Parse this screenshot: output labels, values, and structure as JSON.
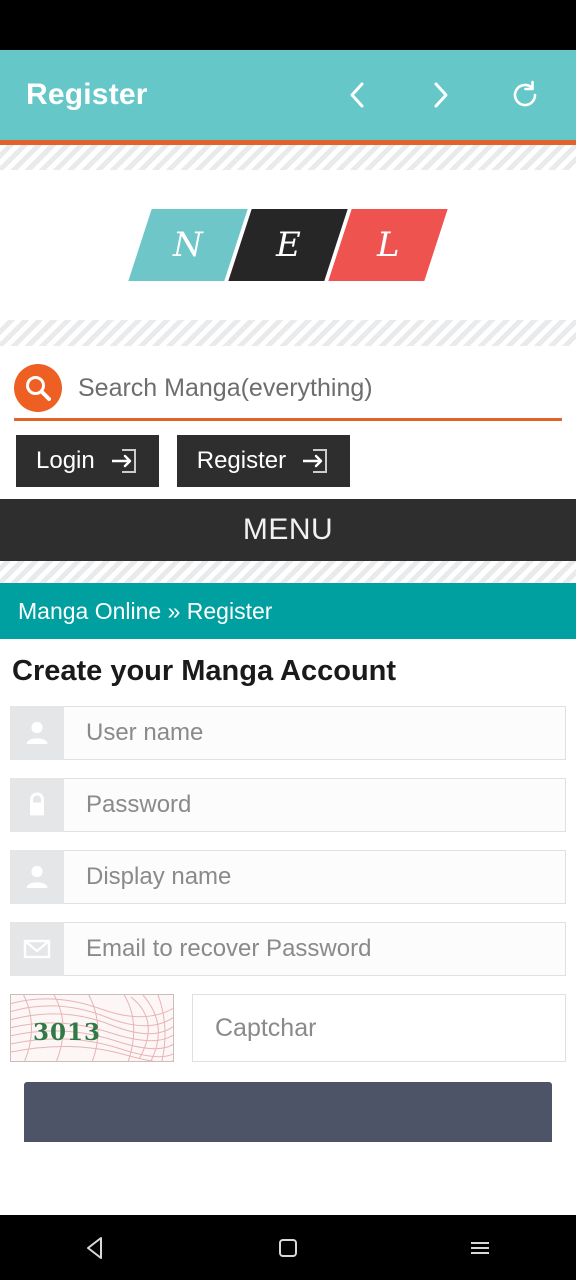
{
  "browser": {
    "title": "Register",
    "icons": {
      "back": "chevron-left-icon",
      "forward": "chevron-right-icon",
      "reload": "refresh-icon"
    }
  },
  "logo": {
    "tiles": [
      {
        "letter": "N",
        "color": "#6ec6c9"
      },
      {
        "letter": "E",
        "color": "#262626"
      },
      {
        "letter": "L",
        "color": "#ef5350"
      }
    ]
  },
  "search": {
    "placeholder": "Search Manga(everything)",
    "value": "",
    "icon": "search-icon",
    "accent_color": "#e2622c"
  },
  "auth": {
    "login_label": "Login",
    "register_label": "Register",
    "icon": "sign-in-icon"
  },
  "menu": {
    "label": "MENU"
  },
  "breadcrumb": {
    "text": "Manga Online » Register",
    "color": "#00a0a0"
  },
  "form": {
    "heading": "Create your Manga Account",
    "fields": [
      {
        "name": "username",
        "placeholder": "User name",
        "value": "",
        "icon": "user-icon",
        "type": "text"
      },
      {
        "name": "password",
        "placeholder": "Password",
        "value": "",
        "icon": "lock-icon",
        "type": "password"
      },
      {
        "name": "displayname",
        "placeholder": "Display name",
        "value": "",
        "icon": "user-icon",
        "type": "text"
      },
      {
        "name": "email",
        "placeholder": "Email to recover Password",
        "value": "",
        "icon": "envelope-icon",
        "type": "text"
      }
    ],
    "captcha": {
      "code": "3013",
      "placeholder": "Captchar",
      "value": ""
    },
    "submit_label": ""
  },
  "android_nav": {
    "back": "back-triangle-icon",
    "home": "home-square-icon",
    "recents": "menu-lines-icon"
  },
  "colors": {
    "browser_header": "#66c7c9",
    "accent_orange": "#e2622c",
    "dark_bar": "#2e2e2e",
    "teal": "#00a0a0",
    "submit": "#4e5468"
  }
}
